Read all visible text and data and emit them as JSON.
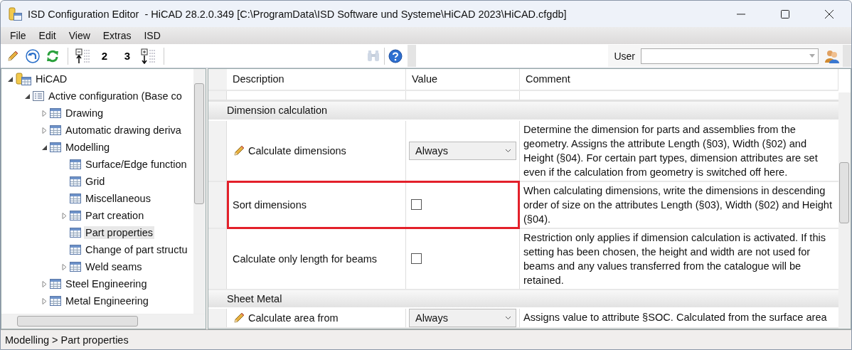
{
  "window": {
    "title": "ISD Configuration Editor  - HiCAD 28.2.0.349 [C:\\ProgramData\\ISD Software und Systeme\\HiCAD 2023\\HiCAD.cfgdb]"
  },
  "menu": [
    "File",
    "Edit",
    "View",
    "Extras",
    "ISD"
  ],
  "toolbar": {
    "buttons": [
      {
        "kind": "pencil",
        "disabled": false
      },
      {
        "kind": "undo",
        "disabled": false
      },
      {
        "kind": "refresh",
        "disabled": false
      },
      {
        "kind": "collapse-levels",
        "disabled": false
      },
      {
        "kind": "level",
        "label": "2",
        "disabled": false
      },
      {
        "kind": "level",
        "label": "3",
        "disabled": false
      },
      {
        "kind": "expand-levels",
        "disabled": false
      }
    ],
    "search": {
      "disabled": true
    },
    "help": {
      "disabled": false
    },
    "user": {
      "label": "User"
    }
  },
  "tree": [
    {
      "label": "HiCAD",
      "kind": "root",
      "expanded": true,
      "selected": false,
      "children": [
        {
          "label": "Active configuration (Base co",
          "kind": "config",
          "expanded": true,
          "selected": false,
          "children": [
            {
              "label": "Drawing",
              "kind": "table",
              "expanded": false,
              "selected": false
            },
            {
              "label": "Automatic drawing deriva",
              "kind": "table",
              "expanded": false,
              "selected": false
            },
            {
              "label": "Modelling",
              "kind": "table",
              "expanded": true,
              "selected": false,
              "children": [
                {
                  "label": "Surface/Edge function",
                  "kind": "table",
                  "selected": false
                },
                {
                  "label": "Grid",
                  "kind": "table",
                  "selected": false
                },
                {
                  "label": "Miscellaneous",
                  "kind": "table",
                  "selected": false
                },
                {
                  "label": "Part creation",
                  "kind": "table",
                  "expanded": false,
                  "selected": false
                },
                {
                  "label": "Part properties",
                  "kind": "table",
                  "selected": true
                },
                {
                  "label": "Change of part structu",
                  "kind": "table",
                  "selected": false
                },
                {
                  "label": "Weld seams",
                  "kind": "table",
                  "expanded": false,
                  "selected": false
                }
              ]
            },
            {
              "label": "Steel Engineering",
              "kind": "table",
              "expanded": false,
              "selected": false
            },
            {
              "label": "Metal Engineering",
              "kind": "table",
              "expanded": false,
              "selected": false
            }
          ]
        }
      ]
    }
  ],
  "grid": {
    "columns": [
      "Description",
      "Value",
      "Comment"
    ],
    "groups": [
      {
        "title": "Dimension calculation",
        "rows": [
          {
            "description": "Calculate dimensions",
            "kind": "dropdown",
            "value": "Always",
            "modified": true,
            "highlighted": false,
            "comment": "Determine the dimension for parts and assemblies from the geometry. Assigns the attribute Length (§03), Width (§02) and Height (§04). For certain part types, dimension attributes are set even if the calculation from geometry is switched off here."
          },
          {
            "description": "Sort dimensions",
            "kind": "checkbox",
            "checked": false,
            "modified": false,
            "highlighted": true,
            "comment": "When calculating dimensions, write the dimensions in descending order of size on the attributes Length (§03), Width (§02) and Height (§04)."
          },
          {
            "description": "Calculate only length for beams",
            "kind": "checkbox",
            "checked": false,
            "modified": false,
            "highlighted": false,
            "comment": "Restriction only applies if dimension calculation is activated. If this setting has been chosen, the height and width are not used for beams and any values transferred from the catalogue will be retained."
          }
        ]
      },
      {
        "title": "Sheet Metal",
        "rows": [
          {
            "description": "Calculate area from",
            "kind": "dropdown",
            "value": "Always",
            "modified": true,
            "highlighted": false,
            "comment": "Assigns value to attribute §SOC. Calculated from the surface area"
          }
        ]
      }
    ]
  },
  "status_bar": {
    "text": "Modelling > Part properties"
  }
}
